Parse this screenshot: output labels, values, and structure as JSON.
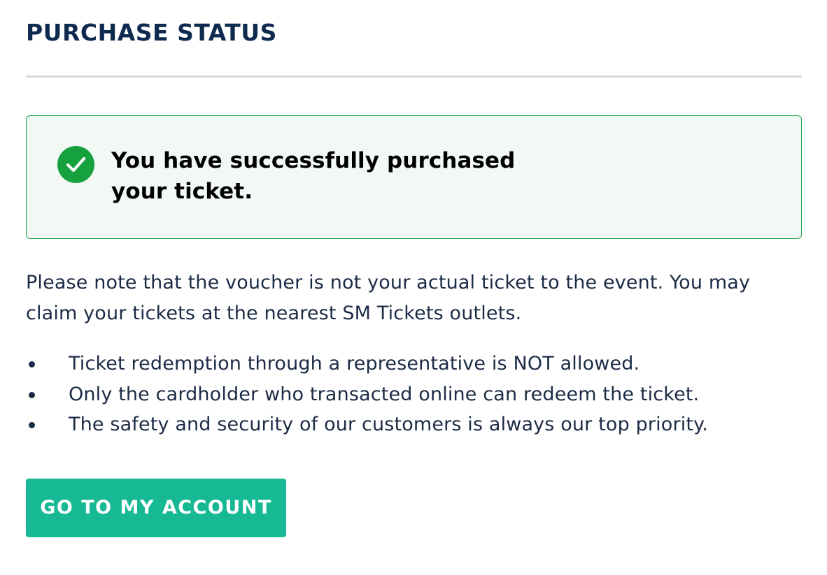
{
  "header": {
    "title": "PURCHASE STATUS"
  },
  "success_box": {
    "icon": "check-circle-icon",
    "message": "You have successfully purchased your ticket.",
    "border_color": "#1aa64a",
    "background_color": "#f2f8f4",
    "icon_color": "#16a13f"
  },
  "note": {
    "text": "Please note that the voucher is not your actual ticket to the event. You may claim your tickets at the nearest SM Tickets outlets."
  },
  "rules": {
    "items": [
      "Ticket redemption through a representative is NOT allowed.",
      "Only the cardholder who transacted online can redeem the ticket.",
      "The safety and security of our customers is always our top priority."
    ]
  },
  "actions": {
    "account_button_label": "GO TO MY ACCOUNT",
    "button_color": "#17b994"
  },
  "colors": {
    "title": "#0e2a4f",
    "body_text": "#1c2b45",
    "divider": "#d8d8d8"
  }
}
